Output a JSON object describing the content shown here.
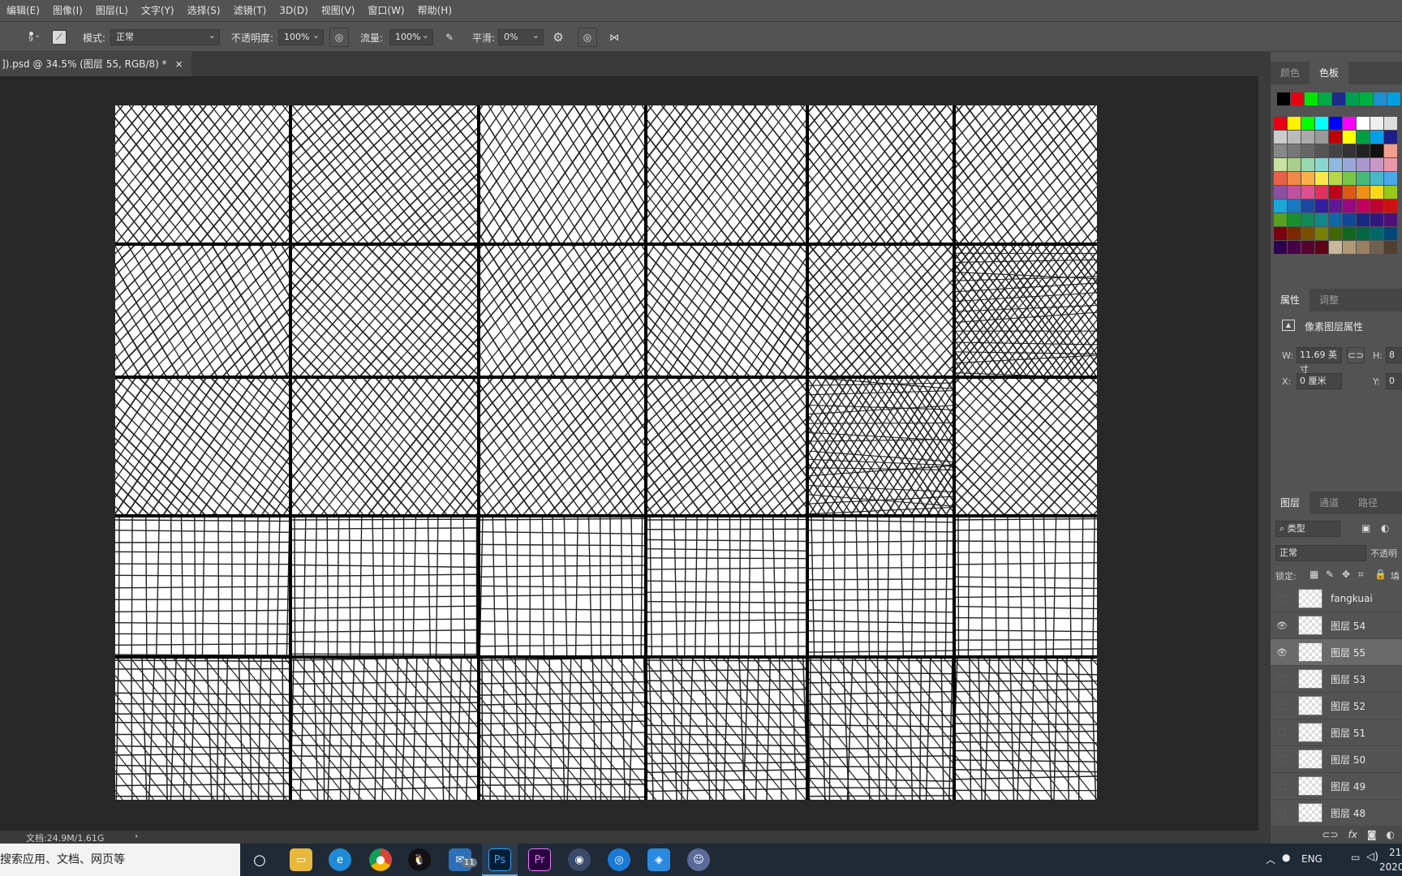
{
  "menu": [
    "编辑(E)",
    "图像(I)",
    "图层(L)",
    "文字(Y)",
    "选择(S)",
    "滤镜(T)",
    "3D(D)",
    "视图(V)",
    "窗口(W)",
    "帮助(H)"
  ],
  "options": {
    "brush_size": "9",
    "mode_label": "模式:",
    "mode_value": "正常",
    "opacity_label": "不透明度:",
    "opacity_value": "100%",
    "flow_label": "流量:",
    "flow_value": "100%",
    "smooth_label": "平滑:",
    "smooth_value": "0%"
  },
  "document": {
    "tab_title": "]).psd @ 34.5% (图层 55, RGB/8) *",
    "close": "×",
    "status": "文档:24.9M/1.61G",
    "status_arrow": "›"
  },
  "canvas": {
    "cols": 6,
    "rows": 5,
    "col_edges": [
      0,
      216,
      448,
      654,
      853,
      1034,
      1210
    ],
    "row_edges": [
      0,
      171,
      335,
      506,
      680,
      856
    ],
    "patterns": [
      [
        "diag",
        "diag",
        "diag",
        "diag",
        "diag",
        "diag"
      ],
      [
        "diag",
        "diag",
        "diag",
        "diag",
        "diag",
        "dense"
      ],
      [
        "diag",
        "diag",
        "diag",
        "diag",
        "dense",
        "diag"
      ],
      [
        "grid",
        "grid",
        "grid",
        "grid",
        "grid",
        "grid"
      ],
      [
        "mix",
        "mix",
        "mix",
        "mix",
        "mix",
        "mix"
      ]
    ]
  },
  "swatch_panel": {
    "tabs": [
      "颜色",
      "色板"
    ],
    "active_tab": "色板",
    "recent": [
      "#000000",
      "#e60012",
      "#00e600",
      "#00aa44",
      "#1e2b8c",
      "#00a050",
      "#00b040",
      "#1e8fd0",
      "#00a0e0"
    ],
    "grid": [
      [
        "#e60012",
        "#fff100",
        "#00ff00",
        "#00ffff",
        "#0000ff",
        "#ff00ff",
        "#ffffff",
        "#eeeeee",
        "#dddddd"
      ],
      [
        "#cccccc",
        "#bbbbbb",
        "#aaaaaa",
        "#999999",
        "#c00000",
        "#ffff00",
        "#00a040",
        "#00a0e9",
        "#1d2088"
      ],
      [
        "#888888",
        "#777777",
        "#666666",
        "#555555",
        "#444444",
        "#333333",
        "#222222",
        "#111111",
        "#f0a090"
      ],
      [
        "#c8e0a0",
        "#a8d08c",
        "#98d8b0",
        "#88d8d0",
        "#90b8e0",
        "#98a8d8",
        "#a898d0",
        "#c898c8",
        "#e898a8"
      ],
      [
        "#e86048",
        "#f08848",
        "#f8b048",
        "#f8e848",
        "#b8d848",
        "#78c848",
        "#48b878",
        "#48b8c8",
        "#48a8e8"
      ],
      [
        "#8850a0",
        "#c050a0",
        "#e05090",
        "#e03060",
        "#c00018",
        "#e05818",
        "#f09018",
        "#f8d818",
        "#98c818"
      ],
      [
        "#18a8d8",
        "#1878c0",
        "#1848a0",
        "#3020a0",
        "#601898",
        "#980880",
        "#c00060",
        "#c00030",
        "#d01010"
      ],
      [
        "#58a020",
        "#18902c",
        "#108858",
        "#108888",
        "#1068a8",
        "#104898",
        "#182880",
        "#301880",
        "#501078"
      ],
      [
        "#7a0010",
        "#7a2800",
        "#7a5000",
        "#788000",
        "#406800",
        "#106820",
        "#006840",
        "#006868",
        "#004878"
      ],
      [
        "#300050",
        "#480048",
        "#580030",
        "#600018",
        "#c8b89a",
        "#b09878",
        "#988060",
        "#706050",
        "#504030"
      ]
    ]
  },
  "properties_panel": {
    "tabs": [
      "属性",
      "调整"
    ],
    "active_tab": "属性",
    "heading": "像素图层属性",
    "w_label": "W:",
    "w_value": "11.69 英寸",
    "h_label": "H:",
    "h_value": "8",
    "x_label": "X:",
    "x_value": "0 厘米",
    "y_label": "Y:",
    "y_value": "0"
  },
  "layers_panel": {
    "tabs": [
      "图层",
      "通道",
      "路径"
    ],
    "active_tab": "图层",
    "filter_value": "类型",
    "blend_value": "正常",
    "opacity_label": "不透明",
    "lock_label": "锁定:",
    "fill_label": "填",
    "layers": [
      {
        "name": "fangkuai",
        "visible": false,
        "selected": false
      },
      {
        "name": "图层 54",
        "visible": true,
        "selected": false
      },
      {
        "name": "图层 55",
        "visible": true,
        "selected": true
      },
      {
        "name": "图层 53",
        "visible": false,
        "selected": false
      },
      {
        "name": "图层 52",
        "visible": false,
        "selected": false
      },
      {
        "name": "图层 51",
        "visible": false,
        "selected": false
      },
      {
        "name": "图层 50",
        "visible": false,
        "selected": false
      },
      {
        "name": "图层 49",
        "visible": false,
        "selected": false
      },
      {
        "name": "图层 48",
        "visible": false,
        "selected": false
      }
    ],
    "footer": "fx"
  },
  "taskbar": {
    "search_text": "搜索应用、文档、网页等",
    "mail_badge": "11",
    "ps_label": "Ps",
    "pr_label": "Pr",
    "lang": "ENG",
    "time": "21",
    "date": "2020"
  }
}
